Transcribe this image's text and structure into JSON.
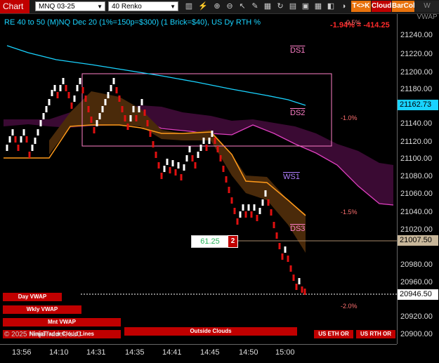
{
  "toolbar": {
    "chart_label": "Chart",
    "instrument": "MNQ 03-25",
    "bar_type": "40 Renko",
    "btn_tk": "T<>K",
    "btn_cloud": "Cloud",
    "btn_barcol": "BarCol",
    "btn_w": "W VWAP",
    "colors": {
      "tk": "#e8720c",
      "cloud": "#c00000",
      "barcol": "#e8720c",
      "w": "#dddddd"
    }
  },
  "chart_title": "RE 40 to 50 (M)NQ Dec 20 (1%=150p=$300) (1 Brick=$40), US Dy RTH %",
  "pnl_text": "-1.94% = -414.25",
  "pct_top": "-0.5%",
  "levels": {
    "ds1": "DS1",
    "ds2": "DS2",
    "ws1": "WS1",
    "ds3": "DS3"
  },
  "pct_labels": {
    "p1": "-1.0%",
    "p15": "-1.5%",
    "p2": "-2.0%"
  },
  "order": {
    "price": "61.25",
    "qty": "2"
  },
  "yaxis": {
    "ticks": [
      "21240.00",
      "21220.00",
      "21200.00",
      "21180.00",
      "21140.00",
      "21120.00",
      "21100.00",
      "21080.00",
      "21060.00",
      "21040.00",
      "21020.00",
      "20980.00",
      "20960.00",
      "20920.00",
      "20900.00"
    ],
    "label_cyan": "21162.73",
    "label_order": "21007.50",
    "label_last": "20946.50"
  },
  "xaxis": {
    "ticks": [
      "13:56",
      "14:10",
      "14:31",
      "14:35",
      "14:41",
      "14:45",
      "14:50",
      "15:00"
    ]
  },
  "buttons": {
    "day_vwap": "Day VWAP",
    "wkly_vwap": "Wkly VWAP",
    "mnt_vwap": "Mnt VWAP",
    "ninja_lines": "NinjaTrader Cloud Lines",
    "outside_clouds": "Outside Clouds",
    "us_eth": "US ETH OR",
    "us_rth": "US RTH OR"
  },
  "copyright": "© 2025 NinjaTrader, LLC"
}
